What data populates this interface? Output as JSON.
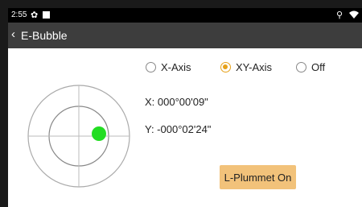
{
  "status_bar": {
    "time": "2:55",
    "icons": [
      "gear-icon",
      "square-icon",
      "location-icon",
      "wifi-icon"
    ]
  },
  "title_bar": {
    "back_icon": "chevron-left-icon",
    "title": "E-Bubble"
  },
  "axis_options": [
    {
      "label": "X-Axis",
      "selected": false
    },
    {
      "label": "XY-Axis",
      "selected": true
    },
    {
      "label": "Off",
      "selected": false
    }
  ],
  "readings": {
    "x": "X:  000°00'09\"",
    "y": "Y:  -000°02'24\""
  },
  "plummet_button": {
    "label": "L-Plummet On"
  },
  "colors": {
    "accent": "#e6a11a",
    "button_bg": "#f2c27a",
    "bubble": "#22dd22",
    "title_bar": "#3d3d3d"
  }
}
